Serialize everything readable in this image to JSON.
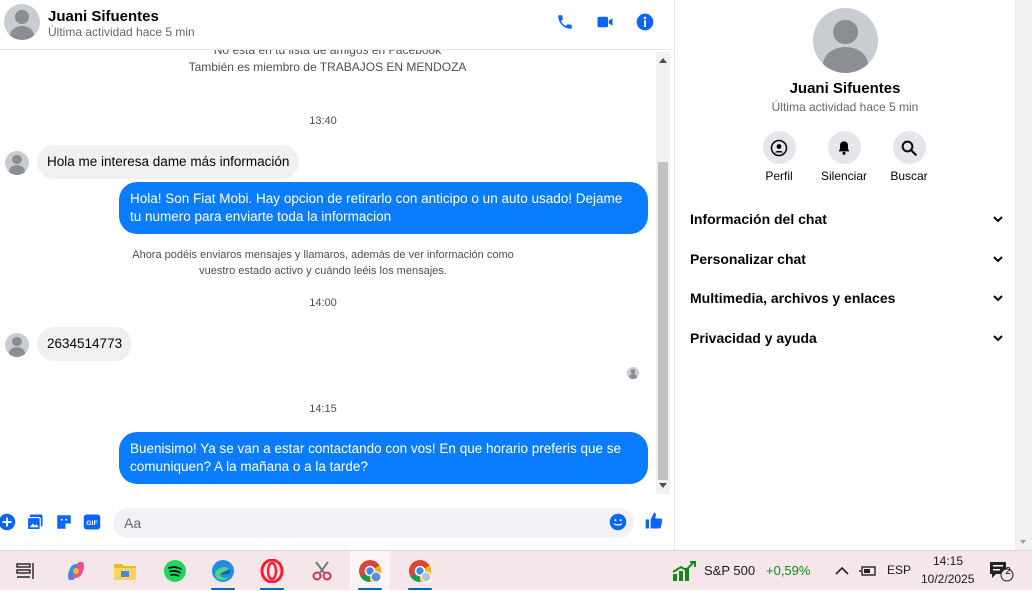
{
  "header": {
    "contact_name": "Juani Sifuentes",
    "status": "Última actividad hace 5 min",
    "icons": [
      "phone-icon",
      "video-camera-icon",
      "info-icon"
    ]
  },
  "messages": {
    "system_note_1": "No está en tu lista de amigos en Facebook",
    "system_note_2": "También es miembro de TRABAJOS EN MENDOZA",
    "time_1": "13:40",
    "incoming_1": "Hola me interesa dame más información",
    "outgoing_1": "Hola! Son Fiat Mobi. Hay opcion de retirarlo con anticipo o un auto usado! Dejame tu numero para enviarte toda la informacion",
    "system_note_3": "Ahora podéis enviaros mensajes y llamaros, además de ver información como vuestro estado activo y cuándo leéis los mensajes.",
    "time_2": "14:00",
    "incoming_2": "2634514773",
    "time_3": "14:15",
    "outgoing_2": "Buenisimo! Ya se van a estar contactando con vos! En que horario preferis que se comuniquen? A la mañana o a la tarde?"
  },
  "composer": {
    "placeholder": "Aa",
    "icons": [
      "plus-icon",
      "photo-icon",
      "sticker-icon",
      "gif-icon",
      "emoji-icon",
      "like-icon"
    ]
  },
  "info_panel": {
    "name": "Juani Sifuentes",
    "status": "Última actividad hace 5 min",
    "actions": [
      {
        "label": "Perfil",
        "icon": "profile-icon"
      },
      {
        "label": "Silenciar",
        "icon": "bell-icon"
      },
      {
        "label": "Buscar",
        "icon": "search-icon"
      }
    ],
    "sections": [
      {
        "label": "Información del chat"
      },
      {
        "label": "Personalizar chat"
      },
      {
        "label": "Multimedia, archivos y enlaces"
      },
      {
        "label": "Privacidad y ayuda"
      }
    ]
  },
  "taskbar": {
    "stock_name": "S&P 500",
    "stock_change": "+0,59%",
    "language": "ESP",
    "time": "14:15",
    "date": "10/2/2025",
    "notification_count": "2",
    "accent_color": "#0067c0"
  },
  "colors": {
    "messenger_blue": "#0a7cff",
    "incoming_bubble": "#f0f0f0",
    "stock_green": "#0e8a16"
  }
}
